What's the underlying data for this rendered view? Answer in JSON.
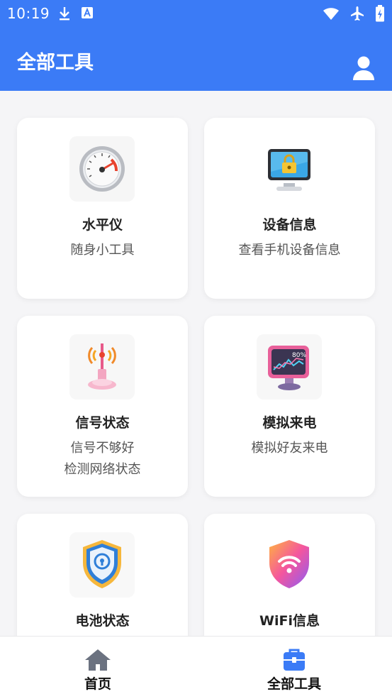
{
  "status": {
    "time": "10:19"
  },
  "appbar": {
    "title": "全部工具"
  },
  "tools": [
    {
      "name": "水平仪",
      "desc": "随身小工具",
      "icon": "speedometer-icon"
    },
    {
      "name": "设备信息",
      "desc": "查看手机设备信息",
      "icon": "monitor-lock-icon"
    },
    {
      "name": "信号状态",
      "desc": "信号不够好\n检测网络状态",
      "icon": "signal-antenna-icon"
    },
    {
      "name": "模拟来电",
      "desc": "模拟好友来电",
      "icon": "monitor-chart-icon"
    },
    {
      "name": "电池状态",
      "desc": "",
      "icon": "shield-lock-icon"
    },
    {
      "name": "WiFi信息",
      "desc": "",
      "icon": "shield-wifi-icon"
    }
  ],
  "nav": {
    "home_label": "首页",
    "tools_label": "全部工具",
    "active_color": "#3b7bf6",
    "inactive_color": "#6b7280"
  },
  "colors": {
    "primary": "#3b7bf6"
  }
}
